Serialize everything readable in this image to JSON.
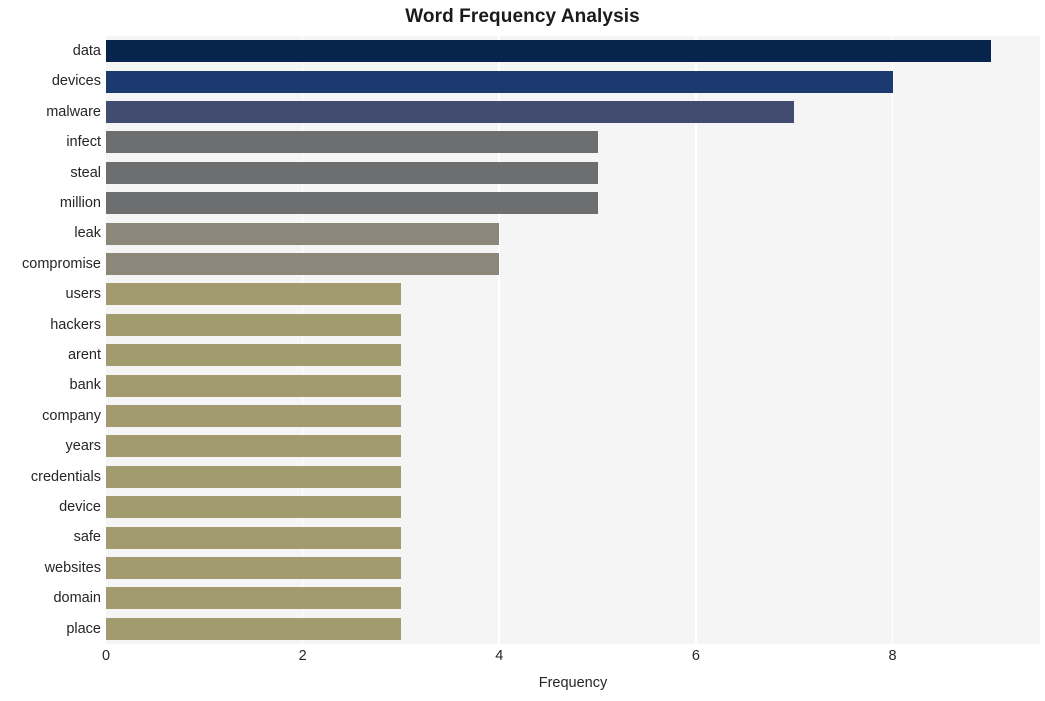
{
  "chart_data": {
    "type": "bar",
    "orientation": "horizontal",
    "title": "Word Frequency Analysis",
    "xlabel": "Frequency",
    "ylabel": "",
    "xlim": [
      0,
      9.5
    ],
    "xticks": [
      0,
      2,
      4,
      6,
      8
    ],
    "xtick_labels": [
      "0",
      "2",
      "4",
      "6",
      "8"
    ],
    "grid": "vertical-white",
    "legend": "none",
    "plot_bgcolor": "#f5f5f5",
    "figure_bgcolor": "#ffffff",
    "categories": [
      "data",
      "devices",
      "malware",
      "infect",
      "steal",
      "million",
      "leak",
      "compromise",
      "users",
      "hackers",
      "arent",
      "bank",
      "company",
      "years",
      "credentials",
      "device",
      "safe",
      "websites",
      "domain",
      "place"
    ],
    "values": [
      9,
      8,
      7,
      5,
      5,
      5,
      4,
      4,
      3,
      3,
      3,
      3,
      3,
      3,
      3,
      3,
      3,
      3,
      3,
      3
    ],
    "bar_colors": [
      "#07244d",
      "#1b3a70",
      "#414c70",
      "#6d6e70",
      "#6d6e70",
      "#6d6e70",
      "#8b877a",
      "#8b877a",
      "#a39b70",
      "#a39b70",
      "#a39b70",
      "#a39b70",
      "#a39b70",
      "#a39b70",
      "#a39b70",
      "#a39b70",
      "#a39b70",
      "#a39b70",
      "#a39b70",
      "#a39b70"
    ]
  }
}
